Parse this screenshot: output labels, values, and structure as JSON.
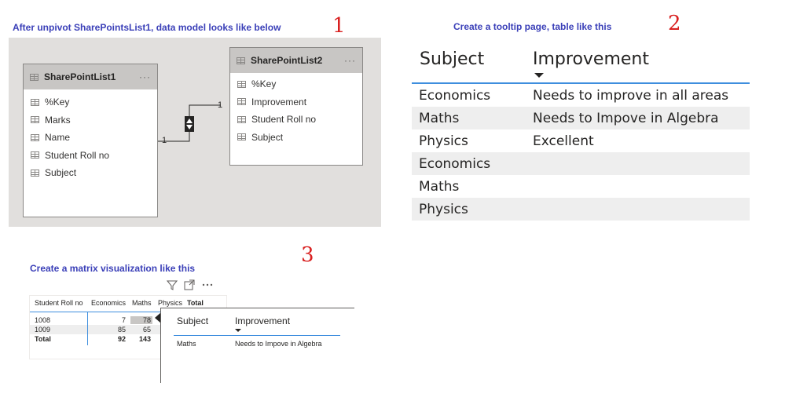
{
  "section1": {
    "heading": "After unpivot SharePointsList1, data model looks like below",
    "marker": "1",
    "table1": {
      "name": "SharePointList1",
      "menu": "···",
      "fields": [
        "%Key",
        "Marks",
        "Name",
        "Student Roll no",
        "Subject"
      ]
    },
    "table2": {
      "name": "SharePointList2",
      "menu": "···",
      "fields": [
        "%Key",
        "Improvement",
        "Student Roll no",
        "Subject"
      ]
    },
    "relationship": {
      "left_cardinality": "1",
      "right_cardinality": "1",
      "icon": "bidirectional-arrow-icon"
    }
  },
  "section2": {
    "heading": "Create a tooltip page, table  like this",
    "marker": "2",
    "columns": [
      "Subject",
      "Improvement"
    ],
    "rows": [
      [
        "Economics",
        "Needs to improve in all areas"
      ],
      [
        "Maths",
        "Needs to Impove in Algebra"
      ],
      [
        "Physics",
        "Excellent"
      ],
      [
        "Economics",
        ""
      ],
      [
        "Maths",
        ""
      ],
      [
        "Physics",
        ""
      ]
    ]
  },
  "section3": {
    "heading": "Create a matrix visualization like this",
    "marker": "3",
    "matrix": {
      "columns": [
        "Student Roll no",
        "Economics",
        "Maths",
        "Physics",
        "Total"
      ],
      "rows": [
        [
          "1008",
          "7",
          "78"
        ],
        [
          "1009",
          "85",
          "65"
        ]
      ],
      "total_row": [
        "Total",
        "92",
        "143"
      ]
    },
    "toolbar_icons": [
      "filter-icon",
      "focus-mode-icon",
      "more-options-icon"
    ],
    "tooltip": {
      "columns": [
        "Subject",
        "Improvement"
      ],
      "rows": [
        [
          "Maths",
          "Needs to Impove in Algebra"
        ]
      ]
    }
  }
}
